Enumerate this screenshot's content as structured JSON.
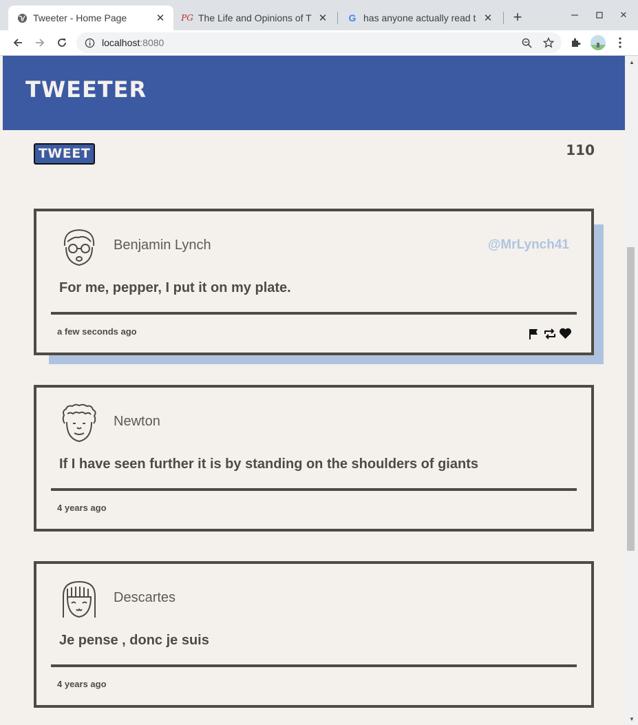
{
  "browser": {
    "tabs": [
      {
        "title": "Tweeter - Home Page",
        "active": true
      },
      {
        "title": "The Life and Opinions of T",
        "active": false
      },
      {
        "title": "has anyone actually read t",
        "active": false
      }
    ],
    "url_host": "localhost",
    "url_port": ":8080"
  },
  "app": {
    "brand": "Tweeter",
    "tweet_button": "Tweet",
    "counter": "110"
  },
  "tweets": [
    {
      "author": "Benjamin Lynch",
      "handle": "@MrLynch41",
      "text": "For me, pepper, I put it on my plate.",
      "time": "a few seconds ago",
      "avatar": "glasses-face-icon"
    },
    {
      "author": "Newton",
      "handle": "",
      "text": "If I have seen further it is by standing on the shoulders of giants",
      "time": "4 years ago",
      "avatar": "curly-hair-face-icon"
    },
    {
      "author": "Descartes",
      "handle": "",
      "text": "Je pense , donc je suis",
      "time": "4 years ago",
      "avatar": "bangs-face-icon"
    }
  ],
  "colors": {
    "header": "#3c5aa2",
    "background": "#f4f1ec",
    "card_border": "#4f4a43",
    "hover_shadow": "#afc3e0"
  }
}
